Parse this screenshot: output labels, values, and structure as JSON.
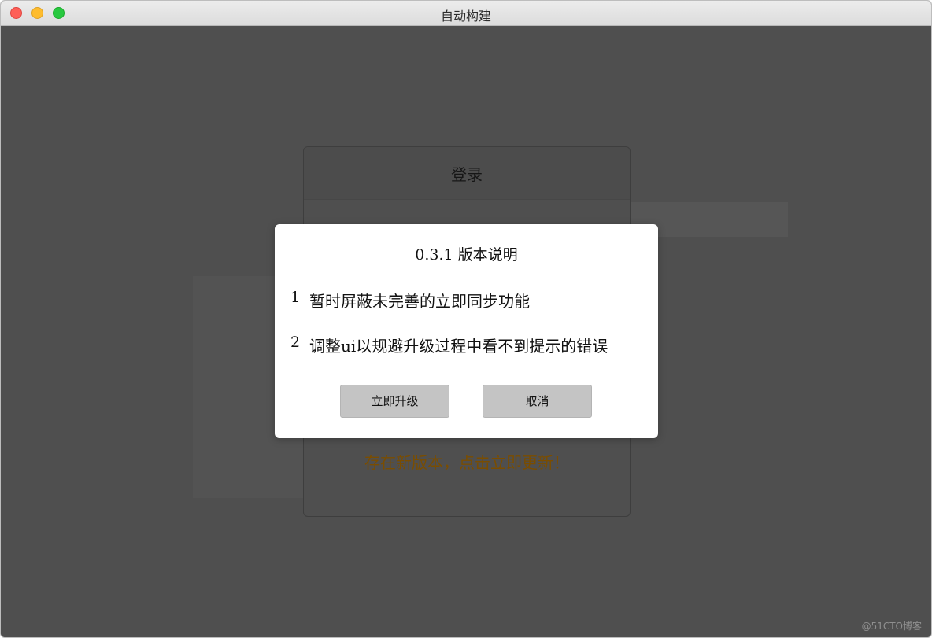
{
  "window": {
    "title": "自动构建"
  },
  "login_panel": {
    "title": "登录",
    "update_link": "存在新版本，点击立即更新！"
  },
  "modal": {
    "title": "0.3.1 版本说明",
    "notes": [
      {
        "number": "1",
        "text": "暂时屏蔽未完善的立即同步功能"
      },
      {
        "number": "2",
        "text": "调整ui以规避升级过程中看不到提示的错误"
      }
    ],
    "buttons": {
      "upgrade_label": "立即升级",
      "cancel_label": "取消"
    }
  },
  "watermark": "@51CTO博客",
  "colors": {
    "overlay": "#4f4f4f",
    "update_link": "#7a4d00",
    "button_bg": "#c4c4c4",
    "close": "#fe5f57",
    "minimize": "#febc2e",
    "maximize": "#28c840"
  }
}
